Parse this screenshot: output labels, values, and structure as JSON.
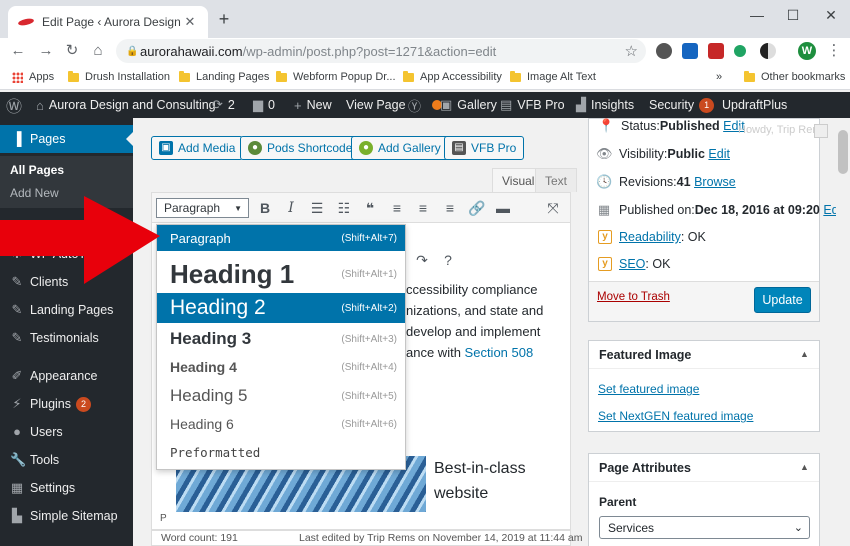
{
  "browser": {
    "tab_title": "Edit Page ‹ Aurora Design and Co",
    "url_domain": "aurorahawaii.com",
    "url_path": "/wp-admin/post.php?post=1271&action=edit",
    "profile_initial": "W"
  },
  "bookmarks": {
    "items": [
      "Apps",
      "Drush Installation",
      "Landing Pages",
      "Webform Popup Dr...",
      "App Accessibility",
      "Image Alt Text"
    ],
    "overflow": "»",
    "other": "Other bookmarks"
  },
  "adminbar": {
    "site": "Aurora Design and Consulting",
    "updates": "2",
    "comments": "0",
    "new": "New",
    "view_page": "View Page",
    "gallery": "Gallery",
    "vfb": "VFB Pro",
    "insights": "Insights",
    "security": "Security",
    "security_count": "1",
    "updraft": "UpdraftPlus",
    "howdy": "Howdy, Trip Rems"
  },
  "sidebar": {
    "pages": "Pages",
    "all_pages": "All Pages",
    "add_new": "Add New",
    "items": [
      "WP AutoTerms",
      "Clients",
      "Landing Pages",
      "Testimonials",
      "Appearance",
      "Plugins",
      "Users",
      "Tools",
      "Settings",
      "Simple Sitemap"
    ],
    "plugins_count": "2"
  },
  "editor": {
    "buttons": [
      "Add Media",
      "Pods Shortcode",
      "Add Gallery",
      "VFB Pro"
    ],
    "tab_visual": "Visual",
    "tab_text": "Text",
    "format_selected": "Paragraph",
    "body_lines": [
      "ccessibility compliance",
      "nizations, and state and",
      "develop and implement",
      "ance with "
    ],
    "body_link": "Section 508",
    "art_text_1": "Best-in-class",
    "art_text_2": "website",
    "path": "P",
    "word_count": "Word count: 191",
    "last_edited": "Last edited by Trip Rems on November 14, 2019 at 11:44 am"
  },
  "format_menu": [
    {
      "label": "Paragraph",
      "shortcut": "(Shift+Alt+7)"
    },
    {
      "label": "Heading 1",
      "shortcut": "(Shift+Alt+1)"
    },
    {
      "label": "Heading 2",
      "shortcut": "(Shift+Alt+2)"
    },
    {
      "label": "Heading 3",
      "shortcut": "(Shift+Alt+3)"
    },
    {
      "label": "Heading 4",
      "shortcut": "(Shift+Alt+4)"
    },
    {
      "label": "Heading 5",
      "shortcut": "(Shift+Alt+5)"
    },
    {
      "label": "Heading 6",
      "shortcut": "(Shift+Alt+6)"
    },
    {
      "label": "Preformatted",
      "shortcut": ""
    }
  ],
  "publish": {
    "status_label": "Status: ",
    "status_value": "Published",
    "visibility_label": "Visibility: ",
    "visibility_value": "Public",
    "revisions_label": "Revisions: ",
    "revisions_value": "41",
    "browse": "Browse",
    "published_on_label": "Published on: ",
    "published_on_value": "Dec 18, 2016 at 09:20",
    "edit": "Edit",
    "readability": "Readability",
    "readability_value": ": OK",
    "seo": "SEO",
    "seo_value": ": OK",
    "trash": "Move to Trash",
    "update": "Update"
  },
  "featured_image": {
    "title": "Featured Image",
    "set": "Set featured image",
    "set_nextgen": "Set NextGEN featured image"
  },
  "page_attributes": {
    "title": "Page Attributes",
    "parent_label": "Parent",
    "parent_value": "Services"
  },
  "colors": {
    "accent": "#0073aa",
    "adminbar": "#23282d",
    "arrow": "#e8000b"
  }
}
